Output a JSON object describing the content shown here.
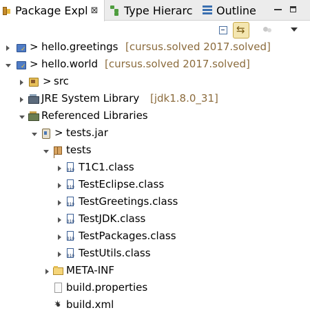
{
  "tabs": [
    {
      "label": "Package Expl",
      "close": "⊠",
      "active": true,
      "icon": "package-explorer-icon"
    },
    {
      "label": "Type Hierarc",
      "active": false,
      "icon": "type-hierarchy-icon"
    },
    {
      "label": "Outline",
      "active": false,
      "icon": "outline-icon"
    }
  ],
  "toolbar": [
    "collapse-all-icon",
    "link-with-editor-icon",
    "filter-icon",
    "view-menu-icon"
  ],
  "tree": [
    {
      "name": "hello.greetings",
      "prefix": ">",
      "decoration": "[cursus.solved 2017.solved]",
      "icon": "project-icon",
      "expanded": false
    },
    {
      "name": "hello.world",
      "prefix": ">",
      "decoration": "[cursus.solved 2017.solved]",
      "icon": "project-icon",
      "expanded": true
    },
    {
      "name": "src",
      "prefix": ">",
      "icon": "source-folder-icon",
      "expanded": false
    },
    {
      "name": "JRE System Library",
      "decoration": "[jdk1.8.0_31]",
      "icon": "library-icon",
      "expanded": false
    },
    {
      "name": "Referenced Libraries",
      "icon": "referenced-libraries-icon",
      "expanded": true
    },
    {
      "name": "tests.jar",
      "prefix": ">",
      "icon": "jar-icon",
      "expanded": true
    },
    {
      "name": "tests",
      "icon": "package-icon",
      "expanded": true
    },
    {
      "name": "T1C1.class",
      "icon": "class-file-icon",
      "expanded": false
    },
    {
      "name": "TestEclipse.class",
      "icon": "class-file-icon",
      "expanded": false
    },
    {
      "name": "TestGreetings.class",
      "icon": "class-file-icon",
      "expanded": false
    },
    {
      "name": "TestJDK.class",
      "icon": "class-file-icon",
      "expanded": false
    },
    {
      "name": "TestPackages.class",
      "icon": "class-file-icon",
      "expanded": false
    },
    {
      "name": "TestUtils.class",
      "icon": "class-file-icon",
      "expanded": false
    },
    {
      "name": "META-INF",
      "icon": "folder-icon",
      "expanded": false
    },
    {
      "name": "build.properties",
      "icon": "file-icon"
    },
    {
      "name": "build.xml",
      "icon": "xml-file-icon"
    }
  ],
  "colors": {
    "decoration": "#8b6b3c",
    "tab_bar": "#ececec",
    "background": "#ffffff"
  }
}
